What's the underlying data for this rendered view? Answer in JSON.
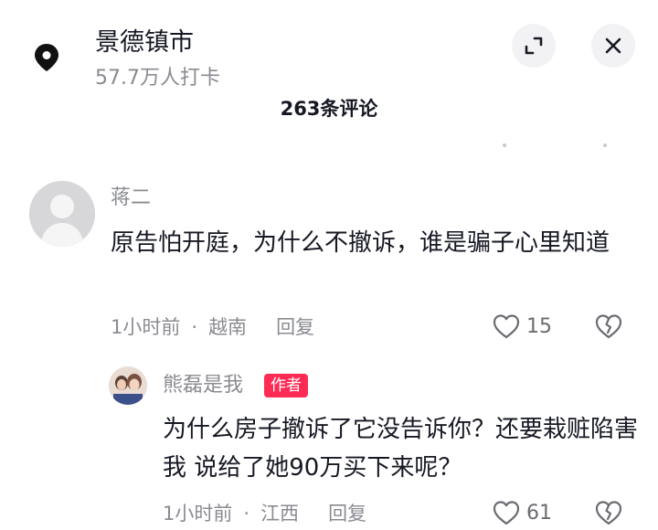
{
  "location": {
    "name": "景德镇市",
    "checkins": "57.7万人打卡",
    "icon": "location-pin-icon"
  },
  "header": {
    "comment_count": "263条评论"
  },
  "comments": [
    {
      "username": "蒋二",
      "text": "原告怕开庭，为什么不撤诉，谁是骗子心里知道",
      "time": "1小时前",
      "region": "越南",
      "reply_label": "回复",
      "likes": "15"
    },
    {
      "username": "熊磊是我",
      "badge": "作者",
      "text": "为什么房子撤诉了它没告诉你？还要栽赃陷害我 说给了她90万买下来呢？",
      "time": "1小时前",
      "region": "江西",
      "reply_label": "回复",
      "likes": "61"
    }
  ],
  "colors": {
    "accent": "#fe2c55",
    "text": "#161823",
    "muted": "#8a8b91"
  }
}
